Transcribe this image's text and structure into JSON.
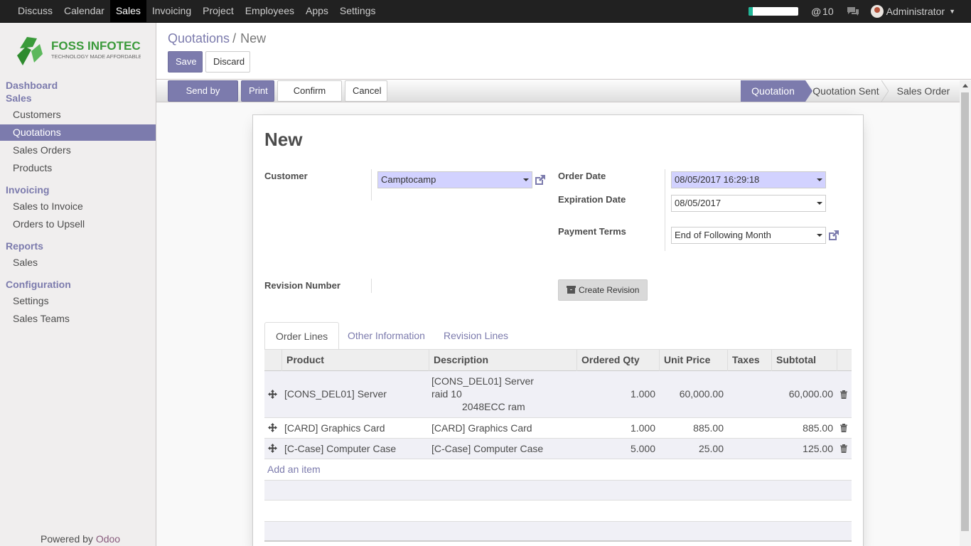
{
  "topbar": {
    "menu": [
      "Discuss",
      "Calendar",
      "Sales",
      "Invoicing",
      "Project",
      "Employees",
      "Apps",
      "Settings"
    ],
    "active_menu": "Sales",
    "progress": 0.08,
    "messages_count": "10",
    "user_name": "Administrator"
  },
  "sidebar": {
    "logo_main": "FOSS INFOTECH",
    "logo_tagline": "TECHNOLOGY MADE AFFORDABLE",
    "dashboard": "Dashboard",
    "sales_head": "Sales",
    "sales_items": [
      "Customers",
      "Quotations",
      "Sales Orders",
      "Products"
    ],
    "invoicing_head": "Invoicing",
    "invoicing_items": [
      "Sales to Invoice",
      "Orders to Upsell"
    ],
    "reports_head": "Reports",
    "reports_items": [
      "Sales"
    ],
    "config_head": "Configuration",
    "config_items": [
      "Settings",
      "Sales Teams"
    ],
    "powered_by": "Powered by",
    "powered_brand": "Odoo"
  },
  "control_panel": {
    "breadcrumb_parent": "Quotations",
    "breadcrumb_sep": "/",
    "breadcrumb_current": "New",
    "save": "Save",
    "discard": "Discard"
  },
  "statusbar": {
    "buttons": [
      "Send by Email",
      "Print",
      "Confirm Sale",
      "Cancel"
    ],
    "stages": [
      "Quotation",
      "Quotation Sent",
      "Sales Order"
    ],
    "active_stage": "Quotation"
  },
  "form": {
    "title": "New",
    "customer_label": "Customer",
    "customer_value": "Camptocamp",
    "order_date_label": "Order Date",
    "order_date_value": "08/05/2017 16:29:18",
    "expiration_label": "Expiration Date",
    "expiration_value": "08/05/2017",
    "payment_terms_label": "Payment Terms",
    "payment_terms_value": "End of Following Month",
    "revision_label": "Revision Number",
    "create_revision": "Create Revision"
  },
  "tabs": [
    "Order Lines",
    "Other Information",
    "Revision Lines"
  ],
  "order_lines": {
    "columns": [
      "Product",
      "Description",
      "Ordered Qty",
      "Unit Price",
      "Taxes",
      "Subtotal"
    ],
    "rows": [
      {
        "product": "[CONS_DEL01] Server",
        "desc1": "[CONS_DEL01] Server",
        "desc2": "raid 10",
        "desc3": "2048ECC ram",
        "qty": "1.000",
        "price": "60,000.00",
        "taxes": "",
        "subtotal": "60,000.00"
      },
      {
        "product": "[CARD] Graphics Card",
        "desc1": "[CARD] Graphics Card",
        "qty": "1.000",
        "price": "885.00",
        "taxes": "",
        "subtotal": "885.00"
      },
      {
        "product": "[C-Case] Computer Case",
        "desc1": "[C-Case] Computer Case",
        "qty": "5.000",
        "price": "25.00",
        "taxes": "",
        "subtotal": "125.00"
      }
    ],
    "add_item": "Add an item"
  },
  "colors": {
    "accent": "#7c7bad",
    "topbar": "#212121",
    "required_field": "#d2d2ff"
  }
}
